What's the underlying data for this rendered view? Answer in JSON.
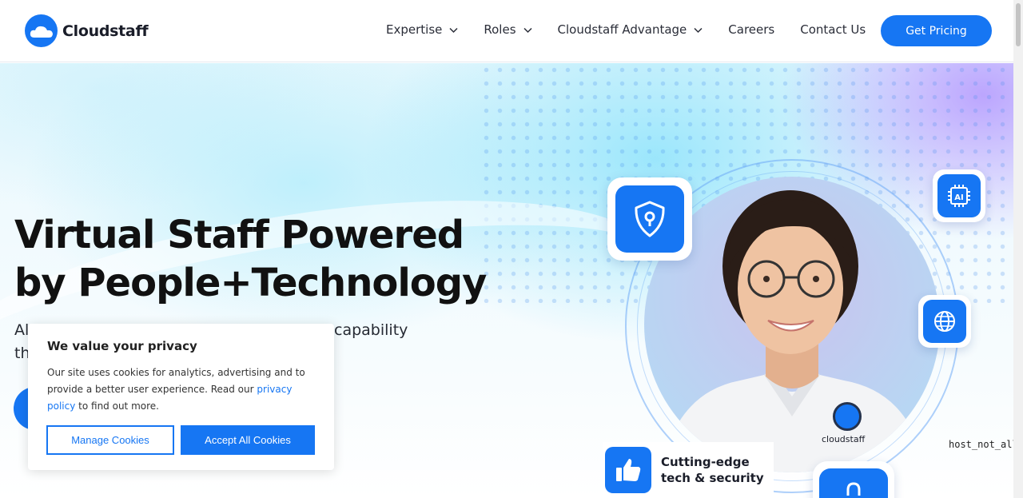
{
  "brand": {
    "name": "Cloudstaff",
    "primary_color": "#1676f3",
    "logo_icon": "cloud-icon"
  },
  "header": {
    "nav": [
      {
        "label": "Expertise",
        "has_dropdown": true
      },
      {
        "label": "Roles",
        "has_dropdown": true
      },
      {
        "label": "Cloudstaff Advantage",
        "has_dropdown": true
      },
      {
        "label": "Careers",
        "has_dropdown": false
      },
      {
        "label": "Contact Us",
        "has_dropdown": false
      }
    ],
    "cta_label": "Get Pricing"
  },
  "hero": {
    "headline_line1": "Virtual Staff Powered",
    "headline_line2": "by People+Technology",
    "subtext_visible_start_line1": "Al",
    "subtext_visible_start_line2": "th",
    "subtext_visible_end": "capability",
    "feature_card_line1": "Cutting-edge",
    "feature_card_line2": "tech & security",
    "feature_icon": "thumbs-up-icon",
    "badges": [
      "shield-lock-icon",
      "ai-chip-icon",
      "globe-icon",
      "lock-icon"
    ],
    "shirt_logo_text": "cloudstaff"
  },
  "error_text": "host_not_all",
  "cookie_banner": {
    "title": "We value your privacy",
    "body_before_link": "Our site uses cookies for analytics, advertising and to provide a better user experience. Read our ",
    "link_text": "privacy policy",
    "body_after_link": " to find out more.",
    "manage_label": "Manage Cookies",
    "accept_label": "Accept All Cookies"
  }
}
